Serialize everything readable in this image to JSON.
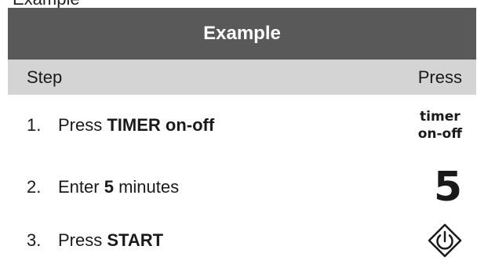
{
  "top_partial_text": "Example",
  "title": "Example",
  "header": {
    "step_label": "Step",
    "press_label": "Press"
  },
  "steps": [
    {
      "number": "1.",
      "prefix": "Press ",
      "bold": "TIMER on-off",
      "suffix": "",
      "key": {
        "line1": "timer",
        "line2": "on-off"
      }
    },
    {
      "number": "2.",
      "prefix": "Enter ",
      "bold": "5",
      "suffix": " minutes",
      "key": {
        "digit": "5"
      }
    },
    {
      "number": "3.",
      "prefix": "Press ",
      "bold": "START",
      "suffix": "",
      "key": {
        "icon": "start-diamond-icon"
      }
    }
  ],
  "colors": {
    "title_bar": "#595959",
    "header_bar": "#d4d4d4"
  }
}
